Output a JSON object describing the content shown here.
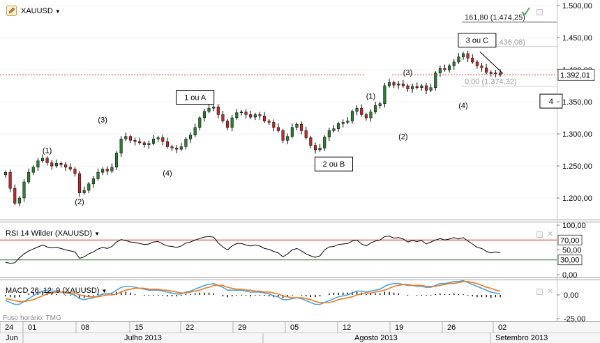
{
  "chart_data": [
    {
      "type": "candlestick",
      "symbol": "XAUUSD",
      "y_ticks": [
        "1.500,00",
        "1.450,00",
        "1.400,00",
        "1.350,00",
        "1.300,00",
        "1.250,00",
        "1.200,00"
      ],
      "y_tick_values": [
        1500,
        1450,
        1400,
        1350,
        1300,
        1250,
        1200
      ],
      "ylim": [
        1165,
        1502
      ],
      "current_price_label": "1.392,01",
      "current_price": 1392.01,
      "close_series": [
        1240,
        1215,
        1192,
        1200,
        1225,
        1240,
        1248,
        1258,
        1262,
        1255,
        1250,
        1254,
        1252,
        1248,
        1245,
        1238,
        1208,
        1212,
        1222,
        1230,
        1240,
        1245,
        1242,
        1248,
        1270,
        1292,
        1296,
        1290,
        1288,
        1286,
        1283,
        1285,
        1292,
        1294,
        1288,
        1280,
        1278,
        1276,
        1280,
        1292,
        1298,
        1310,
        1325,
        1335,
        1340,
        1342,
        1330,
        1320,
        1310,
        1325,
        1333,
        1334,
        1330,
        1326,
        1330,
        1328,
        1320,
        1318,
        1310,
        1305,
        1290,
        1296,
        1310,
        1315,
        1305,
        1294,
        1282,
        1275,
        1278,
        1295,
        1305,
        1308,
        1316,
        1318,
        1320,
        1335,
        1340,
        1330,
        1325,
        1334,
        1344,
        1347,
        1375,
        1380,
        1376,
        1378,
        1375,
        1370,
        1374,
        1372,
        1375,
        1368,
        1372,
        1395,
        1402,
        1400,
        1406,
        1412,
        1420,
        1425,
        1418,
        1412,
        1406,
        1403,
        1396,
        1394,
        1395,
        1392
      ],
      "fibonacci_levels": [
        {
          "label": "161,80 (1.474,25)",
          "value": 1474.25
        },
        {
          "label": "100,00 (1.436,08)",
          "value": 1436.08
        },
        {
          "label": "0,00 (1.374,32)",
          "value": 1374.32
        }
      ],
      "wave_labels": [
        {
          "text": "(1)",
          "value": 1270,
          "index": 9
        },
        {
          "text": "(2)",
          "value": 1190,
          "index": 16
        },
        {
          "text": "(3)",
          "value": 1318,
          "index": 21
        },
        {
          "text": "(4)",
          "value": 1235,
          "index": 35
        },
        {
          "text": "(1)",
          "value": 1355,
          "index": 79
        },
        {
          "text": "(2)",
          "value": 1292,
          "index": 86
        },
        {
          "text": "(3)",
          "value": 1392,
          "index": 87
        },
        {
          "text": "(4)",
          "value": 1340,
          "index": 99
        }
      ],
      "boxed_labels": [
        {
          "text": "1 ou A",
          "value": 1357,
          "index": 41
        },
        {
          "text": "2 ou B",
          "value": 1253,
          "index": 71
        },
        {
          "text": "3 ou C",
          "value": 1446,
          "index": 102
        },
        {
          "text": "4",
          "value": 1351,
          "index": 118
        }
      ]
    },
    {
      "type": "line",
      "title": "RSI 14 Wilder (XAUUSD)",
      "y_ticks": [
        "100,00",
        "50,00",
        "0,00"
      ],
      "y_tick_values": [
        100,
        50,
        0
      ],
      "ylim": [
        0,
        100
      ],
      "levels": [
        {
          "label": "70,00",
          "value": 70
        },
        {
          "label": "30,00",
          "value": 30
        }
      ],
      "values": [
        25,
        23,
        24,
        34,
        42,
        48,
        52,
        56,
        60,
        56,
        54,
        55,
        53,
        50,
        48,
        46,
        33,
        36,
        42,
        46,
        52,
        55,
        53,
        57,
        66,
        71,
        69,
        66,
        65,
        63,
        61,
        62,
        66,
        67,
        62,
        58,
        57,
        55,
        58,
        64,
        66,
        70,
        73,
        76,
        77,
        76,
        64,
        56,
        50,
        58,
        63,
        63,
        60,
        58,
        60,
        58,
        53,
        51,
        47,
        44,
        36,
        42,
        50,
        53,
        48,
        42,
        38,
        35,
        38,
        50,
        56,
        57,
        61,
        62,
        63,
        68,
        70,
        62,
        58,
        64,
        68,
        70,
        77,
        78,
        74,
        75,
        72,
        66,
        69,
        67,
        69,
        62,
        66,
        70,
        73,
        70,
        72,
        75,
        72,
        75,
        68,
        62,
        55,
        53,
        47,
        44,
        46,
        44
      ]
    },
    {
      "type": "line",
      "title": "MACD 26; 12; 9 (XAUUSD)",
      "y_ticks": [
        "0,00",
        "-25,00"
      ],
      "y_tick_values": [
        0,
        -25
      ],
      "ylim": [
        -32,
        18
      ],
      "series": [
        {
          "name": "MACD",
          "color": "#4aa3e0",
          "values": [
            -6,
            -8,
            -10,
            -10,
            -7,
            -4,
            -1,
            2,
            4,
            5,
            4,
            4,
            3,
            2,
            1,
            0,
            -4,
            -5,
            -4,
            -3,
            -1,
            1,
            1,
            2,
            5,
            8,
            9,
            9,
            8,
            7,
            6,
            5,
            5,
            5,
            4,
            3,
            2,
            1,
            1,
            3,
            4,
            6,
            8,
            10,
            11,
            12,
            10,
            8,
            5,
            5,
            5,
            5,
            4,
            3,
            3,
            3,
            2,
            1,
            -1,
            -2,
            -5,
            -5,
            -4,
            -3,
            -4,
            -6,
            -8,
            -10,
            -10,
            -8,
            -6,
            -4,
            -2,
            -1,
            0,
            2,
            4,
            4,
            3,
            4,
            5,
            6,
            9,
            11,
            12,
            12,
            11,
            10,
            10,
            9,
            9,
            8,
            8,
            10,
            12,
            12,
            13,
            14,
            14,
            15,
            13,
            11,
            9,
            7,
            5,
            3,
            2,
            1
          ]
        },
        {
          "name": "Signal",
          "color": "#f07a1f",
          "values": [
            -4,
            -5,
            -6,
            -7,
            -7,
            -6,
            -5,
            -3,
            -1,
            1,
            2,
            3,
            3,
            3,
            2,
            2,
            0,
            -1,
            -2,
            -2,
            -2,
            -1,
            0,
            0,
            1,
            3,
            5,
            6,
            7,
            7,
            7,
            6,
            6,
            6,
            5,
            5,
            4,
            3,
            2,
            2,
            3,
            4,
            5,
            7,
            8,
            10,
            10,
            10,
            8,
            7,
            6,
            6,
            5,
            5,
            4,
            4,
            3,
            3,
            2,
            1,
            -1,
            -2,
            -3,
            -3,
            -3,
            -4,
            -5,
            -7,
            -8,
            -8,
            -8,
            -7,
            -5,
            -4,
            -3,
            -2,
            0,
            1,
            2,
            2,
            3,
            4,
            5,
            7,
            9,
            10,
            11,
            11,
            10,
            10,
            10,
            9,
            9,
            9,
            10,
            11,
            12,
            12,
            13,
            14,
            14,
            13,
            12,
            10,
            8,
            7,
            5,
            4
          ]
        }
      ]
    }
  ],
  "timezone_label": "Fuso horário: TMG",
  "x_ticks": [
    "24",
    "01",
    "08",
    "15",
    "22",
    "29",
    "05",
    "12",
    "19",
    "26",
    "02"
  ],
  "x_months": [
    "Jun",
    "Julho 2013",
    "Agosto 2013",
    "Setembro 2013"
  ],
  "colors": {
    "up": "#2e7d32",
    "down": "#c62828",
    "rsi_70": "#d32f2f",
    "rsi_30": "#2e7d32",
    "price_line": "#d32f2f",
    "fib": "#a0a0a0"
  }
}
